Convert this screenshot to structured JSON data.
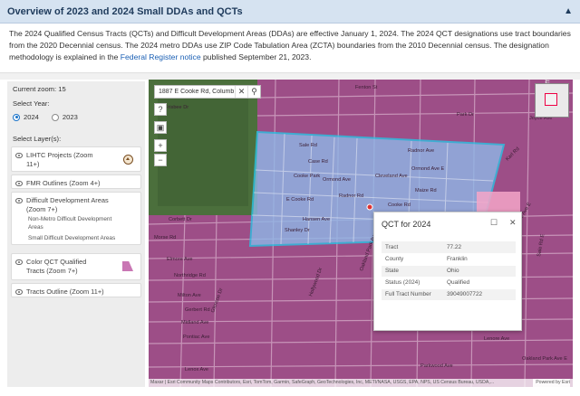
{
  "header": {
    "title": "Overview of 2023 and 2024 Small DDAs and QCTs",
    "collapse_icon": "chevron-up-icon"
  },
  "intro": {
    "text": "The 2024 Qualified Census Tracts (QCTs) and Difficult Development Areas (DDAs) are effective January 1, 2024. The 2024 QCT designations use tract boundaries from the 2020 Decennial census. The 2024 metro DDAs use ZIP Code Tabulation Area (ZCTA) boundaries from the 2010 Decennial census. The designation methodology is explained in the ",
    "link_text": "Federal Register notice",
    "suffix": " published September 21, 2023."
  },
  "sidebar": {
    "current_zoom_label": "Current zoom:",
    "current_zoom_value": "15",
    "select_year_label": "Select Year:",
    "years": [
      "2024",
      "2023"
    ],
    "selected_year": "2024",
    "select_layers_label": "Select Layer(s):",
    "layers": [
      {
        "label": "LIHTC Projects (Zoom 11+)",
        "icon": "house-icon"
      },
      {
        "label": "FMR Outlines (Zoom 4+)"
      },
      {
        "label": "Difficult Development Areas (Zoom 7+)",
        "sublabels": [
          "Non-Metro Difficult Development Areas",
          "Small Difficult Development Areas"
        ]
      },
      {
        "label": "Color QCT Qualified Tracts (Zoom 7+)",
        "swatch_color": "#c977b4"
      },
      {
        "label": "Tracts Outline (Zoom 11+)"
      }
    ]
  },
  "map": {
    "search": {
      "value": "1887 E Cooke Rd, Columb"
    },
    "colors": {
      "qct_fill": "#b85b9e",
      "tract_fill": "#8fb8e8",
      "tract_outline": "#28c4e4",
      "street": "#f2d9e9"
    },
    "street_labels": [
      "Fenton St",
      "Frisbee Dr",
      "Sale Rd",
      "Case Rd",
      "Ormond Ave",
      "Radnor Rd",
      "Cooke Park",
      "E Cooke Rd",
      "Cooke Rd",
      "Hansen Ave",
      "Shanley Dr",
      "Corbett Dr",
      "Morse Rd",
      "Elmore Ave",
      "Northridge Rd",
      "Milton Ave",
      "Gerbert Rd",
      "Midland Ave",
      "Pontiac Ave",
      "Lenox Ave",
      "Lenore Ave",
      "Glencoe Dr",
      "Hollywood Dr",
      "Oakland Park Ave",
      "Mifflinville",
      "Joyce Ave",
      "Cleveland Ave",
      "Karl Rd",
      "Parkwood Ave",
      "Park Dr",
      "Radnor Ave",
      "Ormond Ave E",
      "Maize Rd",
      "Frisbee Ave",
      "Sale Rd E",
      "Midland Ave E",
      "Oakland Park Ave E"
    ],
    "popup": {
      "title": "QCT for 2024",
      "rows": [
        {
          "label": "Tract",
          "value": "77.22"
        },
        {
          "label": "County",
          "value": "Franklin"
        },
        {
          "label": "State",
          "value": "Ohio"
        },
        {
          "label": "Status (2024)",
          "value": "Qualified"
        },
        {
          "label": "Full Tract Number",
          "value": "39049007722"
        }
      ]
    },
    "attribution": "Maxar | Esri Community Maps Contributors, Esri, TomTom, Garmin, SafeGraph, GeoTechnologies, Inc, METI/NASA, USGS, EPA, NPS, US Census Bureau, USDA,...",
    "attribution_right": "Powered by Esri"
  }
}
